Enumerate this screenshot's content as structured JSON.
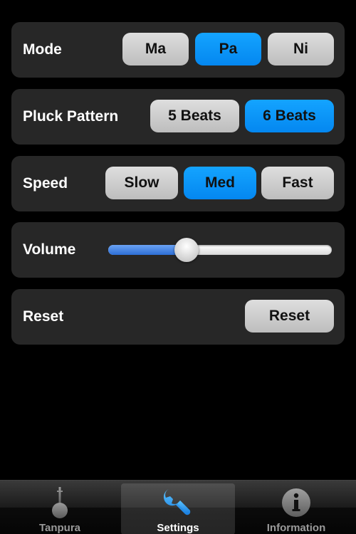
{
  "settings": {
    "mode": {
      "label": "Mode",
      "options": [
        "Ma",
        "Pa",
        "Ni"
      ],
      "selected": "Pa"
    },
    "pluck_pattern": {
      "label": "Pluck Pattern",
      "options": [
        "5 Beats",
        "6 Beats"
      ],
      "selected": "6 Beats"
    },
    "speed": {
      "label": "Speed",
      "options": [
        "Slow",
        "Med",
        "Fast"
      ],
      "selected": "Med"
    },
    "volume": {
      "label": "Volume",
      "level": 0.35
    },
    "reset": {
      "label": "Reset",
      "button_label": "Reset"
    }
  },
  "tabbar": {
    "tabs": [
      {
        "label": "Tanpura",
        "icon": "tanpura-icon",
        "selected": false
      },
      {
        "label": "Settings",
        "icon": "wrench-icon",
        "selected": true
      },
      {
        "label": "Information",
        "icon": "info-icon",
        "selected": false
      }
    ]
  },
  "colors": {
    "accent": "#0a95f8",
    "panel": "#272727",
    "background": "#000000"
  }
}
